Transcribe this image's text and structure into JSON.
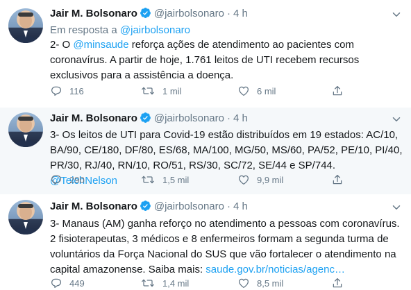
{
  "tweets": [
    {
      "author": "Jair M. Bolsonaro",
      "handle": "@jairbolsonaro",
      "time": "4 h",
      "reply_prefix": "Em resposta a ",
      "reply_handle": "@jairbolsonaro",
      "text_a": "2- O ",
      "mention": "@minsaude",
      "text_b": " reforça ações de atendimento ao pacientes com coronavírus. A partir de hoje, 1.761 leitos de UTI recebem recursos exclusivos para a assistência a doença.",
      "replies": "116",
      "retweets": "1 mil",
      "likes": "6 mil"
    },
    {
      "author": "Jair M. Bolsonaro",
      "handle": "@jairbolsonaro",
      "time": "4 h",
      "text_a": "3- Os leitos de UTI para Covid-19 estão distribuídos em 19 estados: AC/10, BA/90, CE/180, DF/80, ES/68, MA/100, MG/50, MS/60, PA/52, PE/10, PI/40, PR/30, RJ/40, RN/10, RO/51, RS/30, SC/72, SE/44 e SP/744. ",
      "mention": "@TeichNelson",
      "replies": "290",
      "retweets": "1,5 mil",
      "likes": "9,9 mil"
    },
    {
      "author": "Jair M. Bolsonaro",
      "handle": "@jairbolsonaro",
      "time": "4 h",
      "text_a": "3- Manaus (AM) ganha reforço no atendimento a pessoas com coronavírus. 2 fisioterapeutas, 3 médicos e 8 enfermeiros formam a segunda turma de voluntários da Força Nacional do SUS que vão fortalecer o atendimento na capital amazonense. Saiba mais: ",
      "link": "saude.gov.br/noticias/agenc…",
      "replies": "449",
      "retweets": "1,4 mil",
      "likes": "8,5 mil"
    }
  ],
  "colors": {
    "link": "#1da1f2",
    "muted": "#657786",
    "highlight_bg": "#f5f8fa",
    "divider": "#e6ecf0"
  },
  "icons": [
    "verified-badge-icon",
    "chevron-down-icon",
    "reply-icon",
    "retweet-icon",
    "like-icon",
    "share-icon"
  ]
}
